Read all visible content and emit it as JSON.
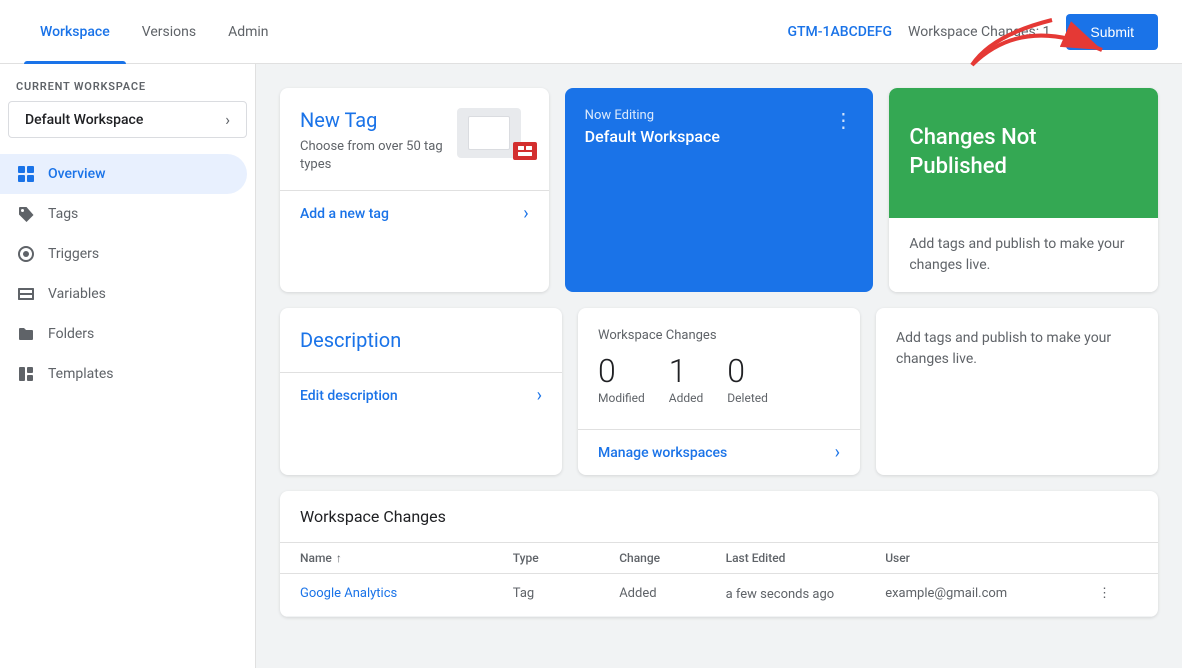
{
  "nav": {
    "tabs": [
      {
        "id": "workspace",
        "label": "Workspace",
        "active": true
      },
      {
        "id": "versions",
        "label": "Versions",
        "active": false
      },
      {
        "id": "admin",
        "label": "Admin",
        "active": false
      }
    ],
    "gtm_id": "GTM-1ABCDEFG",
    "workspace_changes_label": "Workspace Changes: 1",
    "submit_label": "Submit"
  },
  "sidebar": {
    "current_workspace_label": "CURRENT WORKSPACE",
    "workspace_name": "Default Workspace",
    "nav_items": [
      {
        "id": "overview",
        "label": "Overview",
        "icon": "grid",
        "active": true
      },
      {
        "id": "tags",
        "label": "Tags",
        "icon": "tag",
        "active": false
      },
      {
        "id": "triggers",
        "label": "Triggers",
        "icon": "trigger",
        "active": false
      },
      {
        "id": "variables",
        "label": "Variables",
        "icon": "variable",
        "active": false
      },
      {
        "id": "folders",
        "label": "Folders",
        "icon": "folder",
        "active": false
      },
      {
        "id": "templates",
        "label": "Templates",
        "icon": "template",
        "active": false
      }
    ]
  },
  "main": {
    "new_tag_card": {
      "title": "New Tag",
      "subtitle": "Choose from over 50 tag types",
      "action_label": "Add a new tag"
    },
    "now_editing_card": {
      "label": "Now Editing",
      "workspace_name": "Default Workspace",
      "dots": "⋮"
    },
    "not_published_card": {
      "title": "Changes Not Published",
      "description": "Add tags and publish to make your changes live."
    },
    "description_card": {
      "title": "Description",
      "action_label": "Edit description"
    },
    "workspace_changes_card": {
      "title": "Workspace Changes",
      "stats": [
        {
          "number": "0",
          "label": "Modified"
        },
        {
          "number": "1",
          "label": "Added"
        },
        {
          "number": "0",
          "label": "Deleted"
        }
      ],
      "action_label": "Manage workspaces"
    },
    "table": {
      "title": "Workspace Changes",
      "headers": {
        "name": "Name",
        "type": "Type",
        "change": "Change",
        "last_edited": "Last Edited",
        "user": "User"
      },
      "rows": [
        {
          "name": "Google Analytics",
          "type": "Tag",
          "change": "Added",
          "last_edited": "a few seconds ago",
          "user": "example@gmail.com"
        }
      ]
    }
  }
}
